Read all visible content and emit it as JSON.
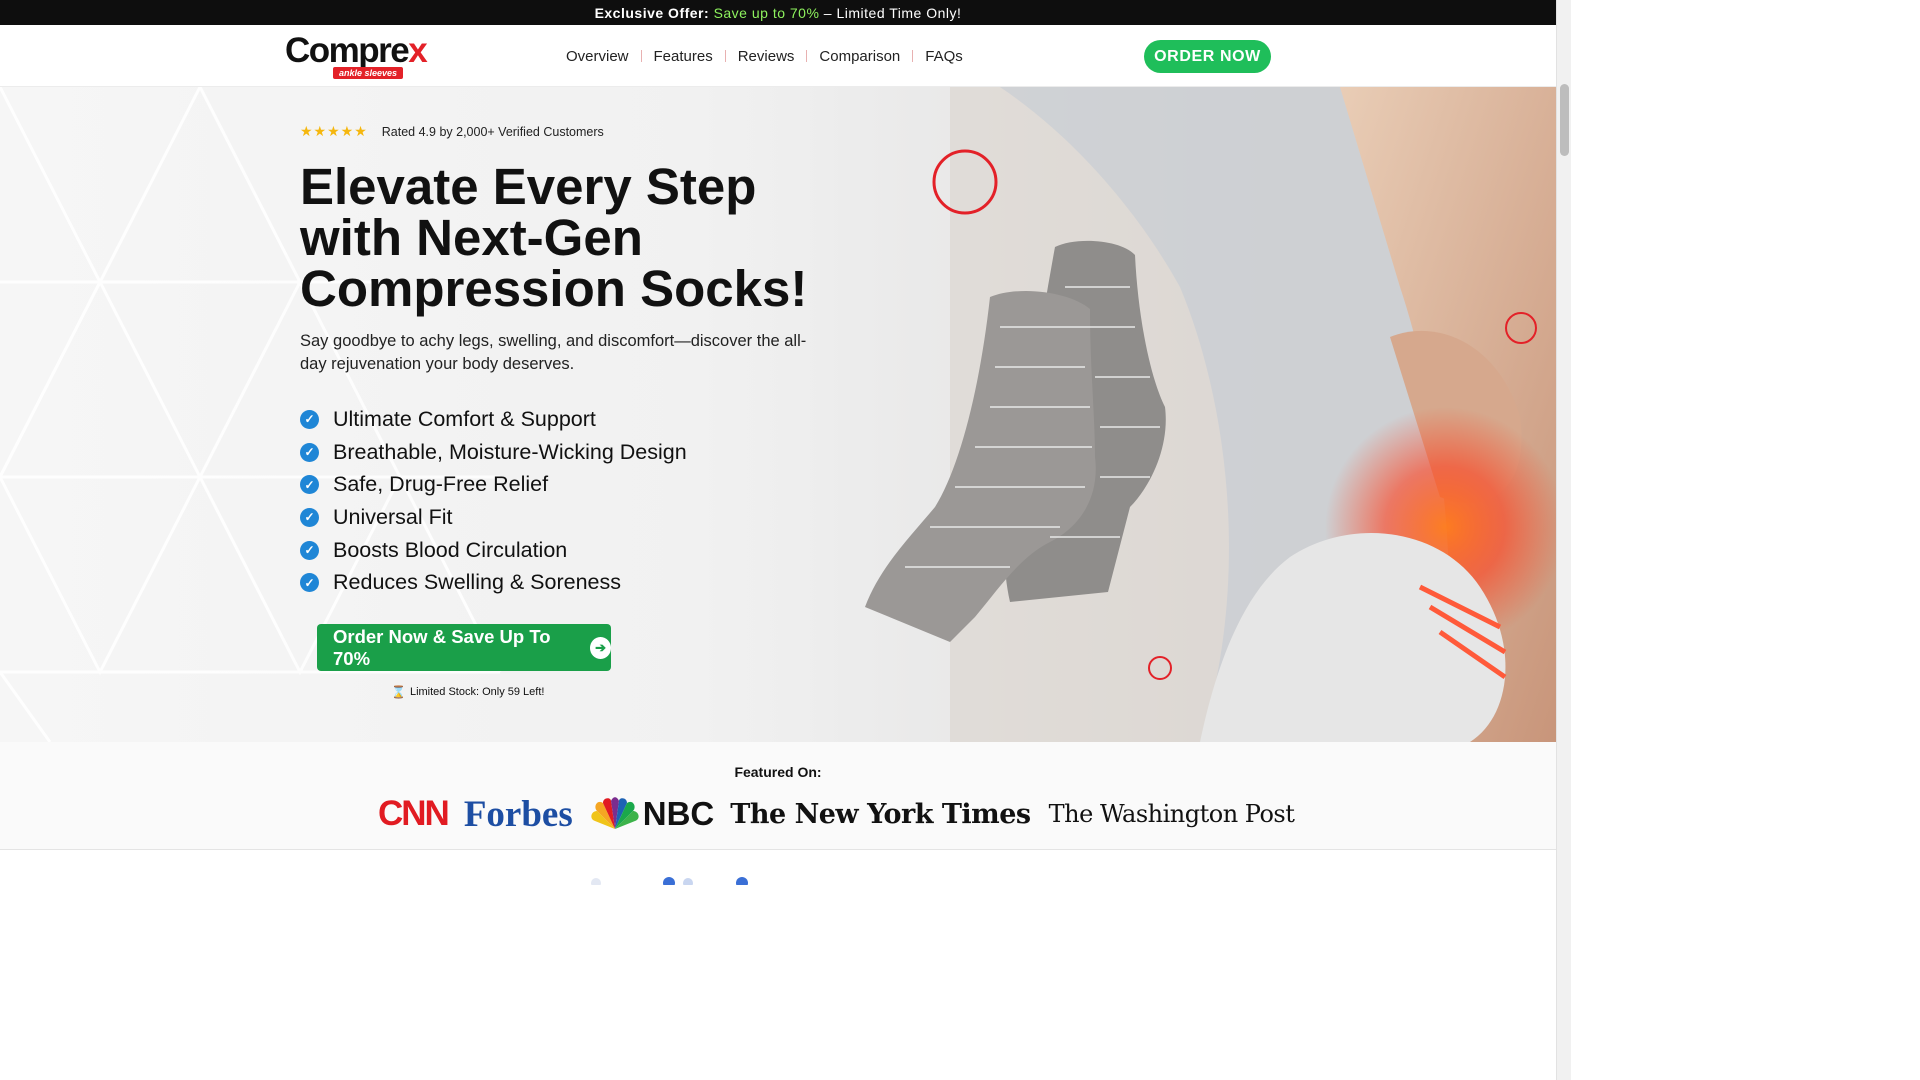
{
  "announcement": {
    "prefix": "Exclusive Offer:",
    "highlight": "Save up to 70%",
    "suffix": " – Limited Time Only!"
  },
  "brand": {
    "name_main": "Compre",
    "name_x": "x",
    "tagline": "ankle sleeves"
  },
  "nav": {
    "items": [
      "Overview",
      "Features",
      "Reviews",
      "Comparison",
      "FAQs"
    ],
    "order_button": "ORDER NOW"
  },
  "hero": {
    "stars": "★★★★★",
    "rating_text": "Rated 4.9 by 2,000+ Verified Customers",
    "headline": "Elevate Every Step with Next-Gen Compression Socks!",
    "subcopy": "Say goodbye to achy legs, swelling, and discomfort—discover the all-day rejuvenation your body deserves.",
    "features": [
      "Ultimate Comfort & Support",
      "Breathable, Moisture-Wicking Design",
      "Safe, Drug-Free Relief",
      "Universal Fit",
      "Boosts Blood Circulation",
      "Reduces Swelling & Soreness"
    ],
    "cta_label": "Order Now & Save Up To 70%",
    "stock_text": "Limited Stock: Only 59 Left!"
  },
  "featured": {
    "label": "Featured On:",
    "logos": [
      "CNN",
      "Forbes",
      "NBC",
      "The New York Times",
      "The Washington Post"
    ]
  },
  "icons": {
    "check": "check-circle-icon",
    "arrow": "arrow-right-icon",
    "hourglass": "hourglass-icon",
    "star": "star-icon"
  },
  "colors": {
    "accent_green": "#1fbe5a",
    "cta_green": "#1a9f49",
    "brand_red": "#e32128",
    "check_blue": "#1f86d6",
    "offer_green": "#8ef25e",
    "topbar_bg": "#0e0e0e"
  }
}
